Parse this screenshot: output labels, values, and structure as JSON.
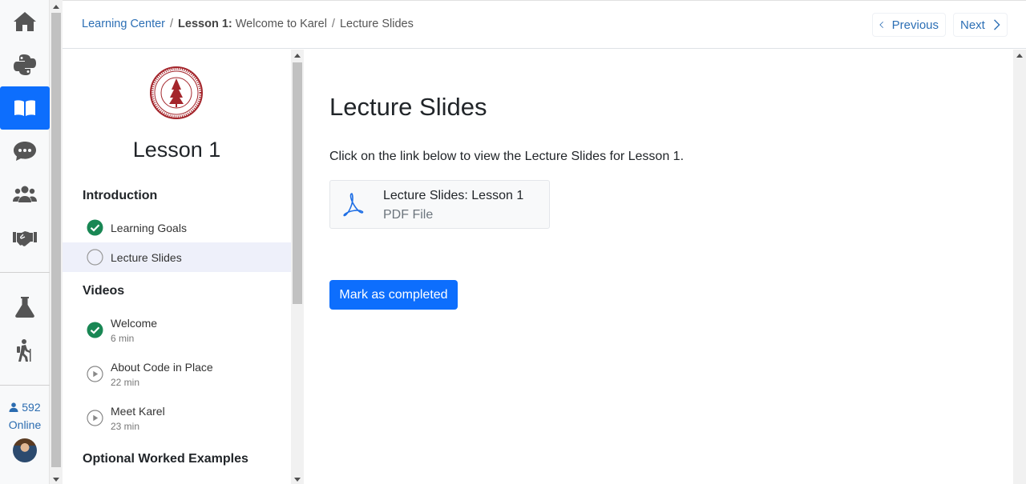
{
  "rail": {
    "items": [
      {
        "name": "home"
      },
      {
        "name": "python"
      },
      {
        "name": "learning-center",
        "active": true
      },
      {
        "name": "forum"
      },
      {
        "name": "community"
      },
      {
        "name": "handshake"
      },
      {
        "name": "lab"
      },
      {
        "name": "hiking"
      }
    ],
    "online_count": "592",
    "online_label": "Online"
  },
  "breadcrumb": {
    "root": "Learning Center",
    "lesson_bold": "Lesson 1:",
    "lesson_name": " Welcome to Karel",
    "current": "Lecture Slides",
    "separator": "/"
  },
  "nav": {
    "previous": "Previous",
    "next": "Next"
  },
  "sidebar": {
    "lesson_title": "Lesson 1",
    "sections": [
      {
        "title": "Introduction"
      },
      {
        "title": "Videos"
      },
      {
        "title": "Optional Worked Examples"
      }
    ],
    "items": [
      {
        "label": "Learning Goals",
        "status": "done"
      },
      {
        "label": "Lecture Slides",
        "status": "current"
      },
      {
        "label": "Welcome",
        "sub": "6 min",
        "status": "done"
      },
      {
        "label": "About Code in Place",
        "sub": "22 min",
        "status": "video"
      },
      {
        "label": "Meet Karel",
        "sub": "23 min",
        "status": "video"
      }
    ]
  },
  "main": {
    "title": "Lecture Slides",
    "description": "Click on the link below to view the Lecture Slides for Lesson 1.",
    "file": {
      "name": "Lecture Slides: Lesson 1",
      "type": "PDF File"
    },
    "complete_button": "Mark as completed"
  },
  "colors": {
    "accent": "#0d6efd",
    "success": "#198754",
    "link": "#2c6fb5",
    "seal": "#a4262c"
  }
}
